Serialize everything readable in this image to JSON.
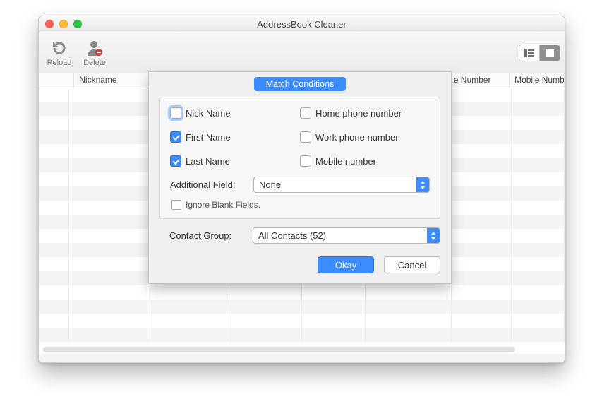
{
  "window": {
    "title": "AddressBook Cleaner"
  },
  "toolbar": {
    "reload_label": "Reload",
    "delete_label": "Delete"
  },
  "columns": [
    "",
    "Nickname",
    "",
    "",
    "",
    "",
    "e Number",
    "Mobile Number"
  ],
  "modal": {
    "tab_label": "Match Conditions",
    "checks": {
      "nick": {
        "label": "Nick Name",
        "checked": false,
        "focus": true
      },
      "first": {
        "label": "First Name",
        "checked": true,
        "focus": false
      },
      "last": {
        "label": "Last Name",
        "checked": true,
        "focus": false
      },
      "home": {
        "label": "Home phone number",
        "checked": false,
        "focus": false
      },
      "work": {
        "label": "Work phone number",
        "checked": false,
        "focus": false
      },
      "mobile": {
        "label": "Mobile number",
        "checked": false,
        "focus": false
      }
    },
    "additional_label": "Additional Field:",
    "additional_value": "None",
    "ignore_label": "Ignore Blank Fields.",
    "ignore_checked": false,
    "group_label": "Contact Group:",
    "group_value": "All Contacts (52)",
    "okay_label": "Okay",
    "cancel_label": "Cancel"
  }
}
